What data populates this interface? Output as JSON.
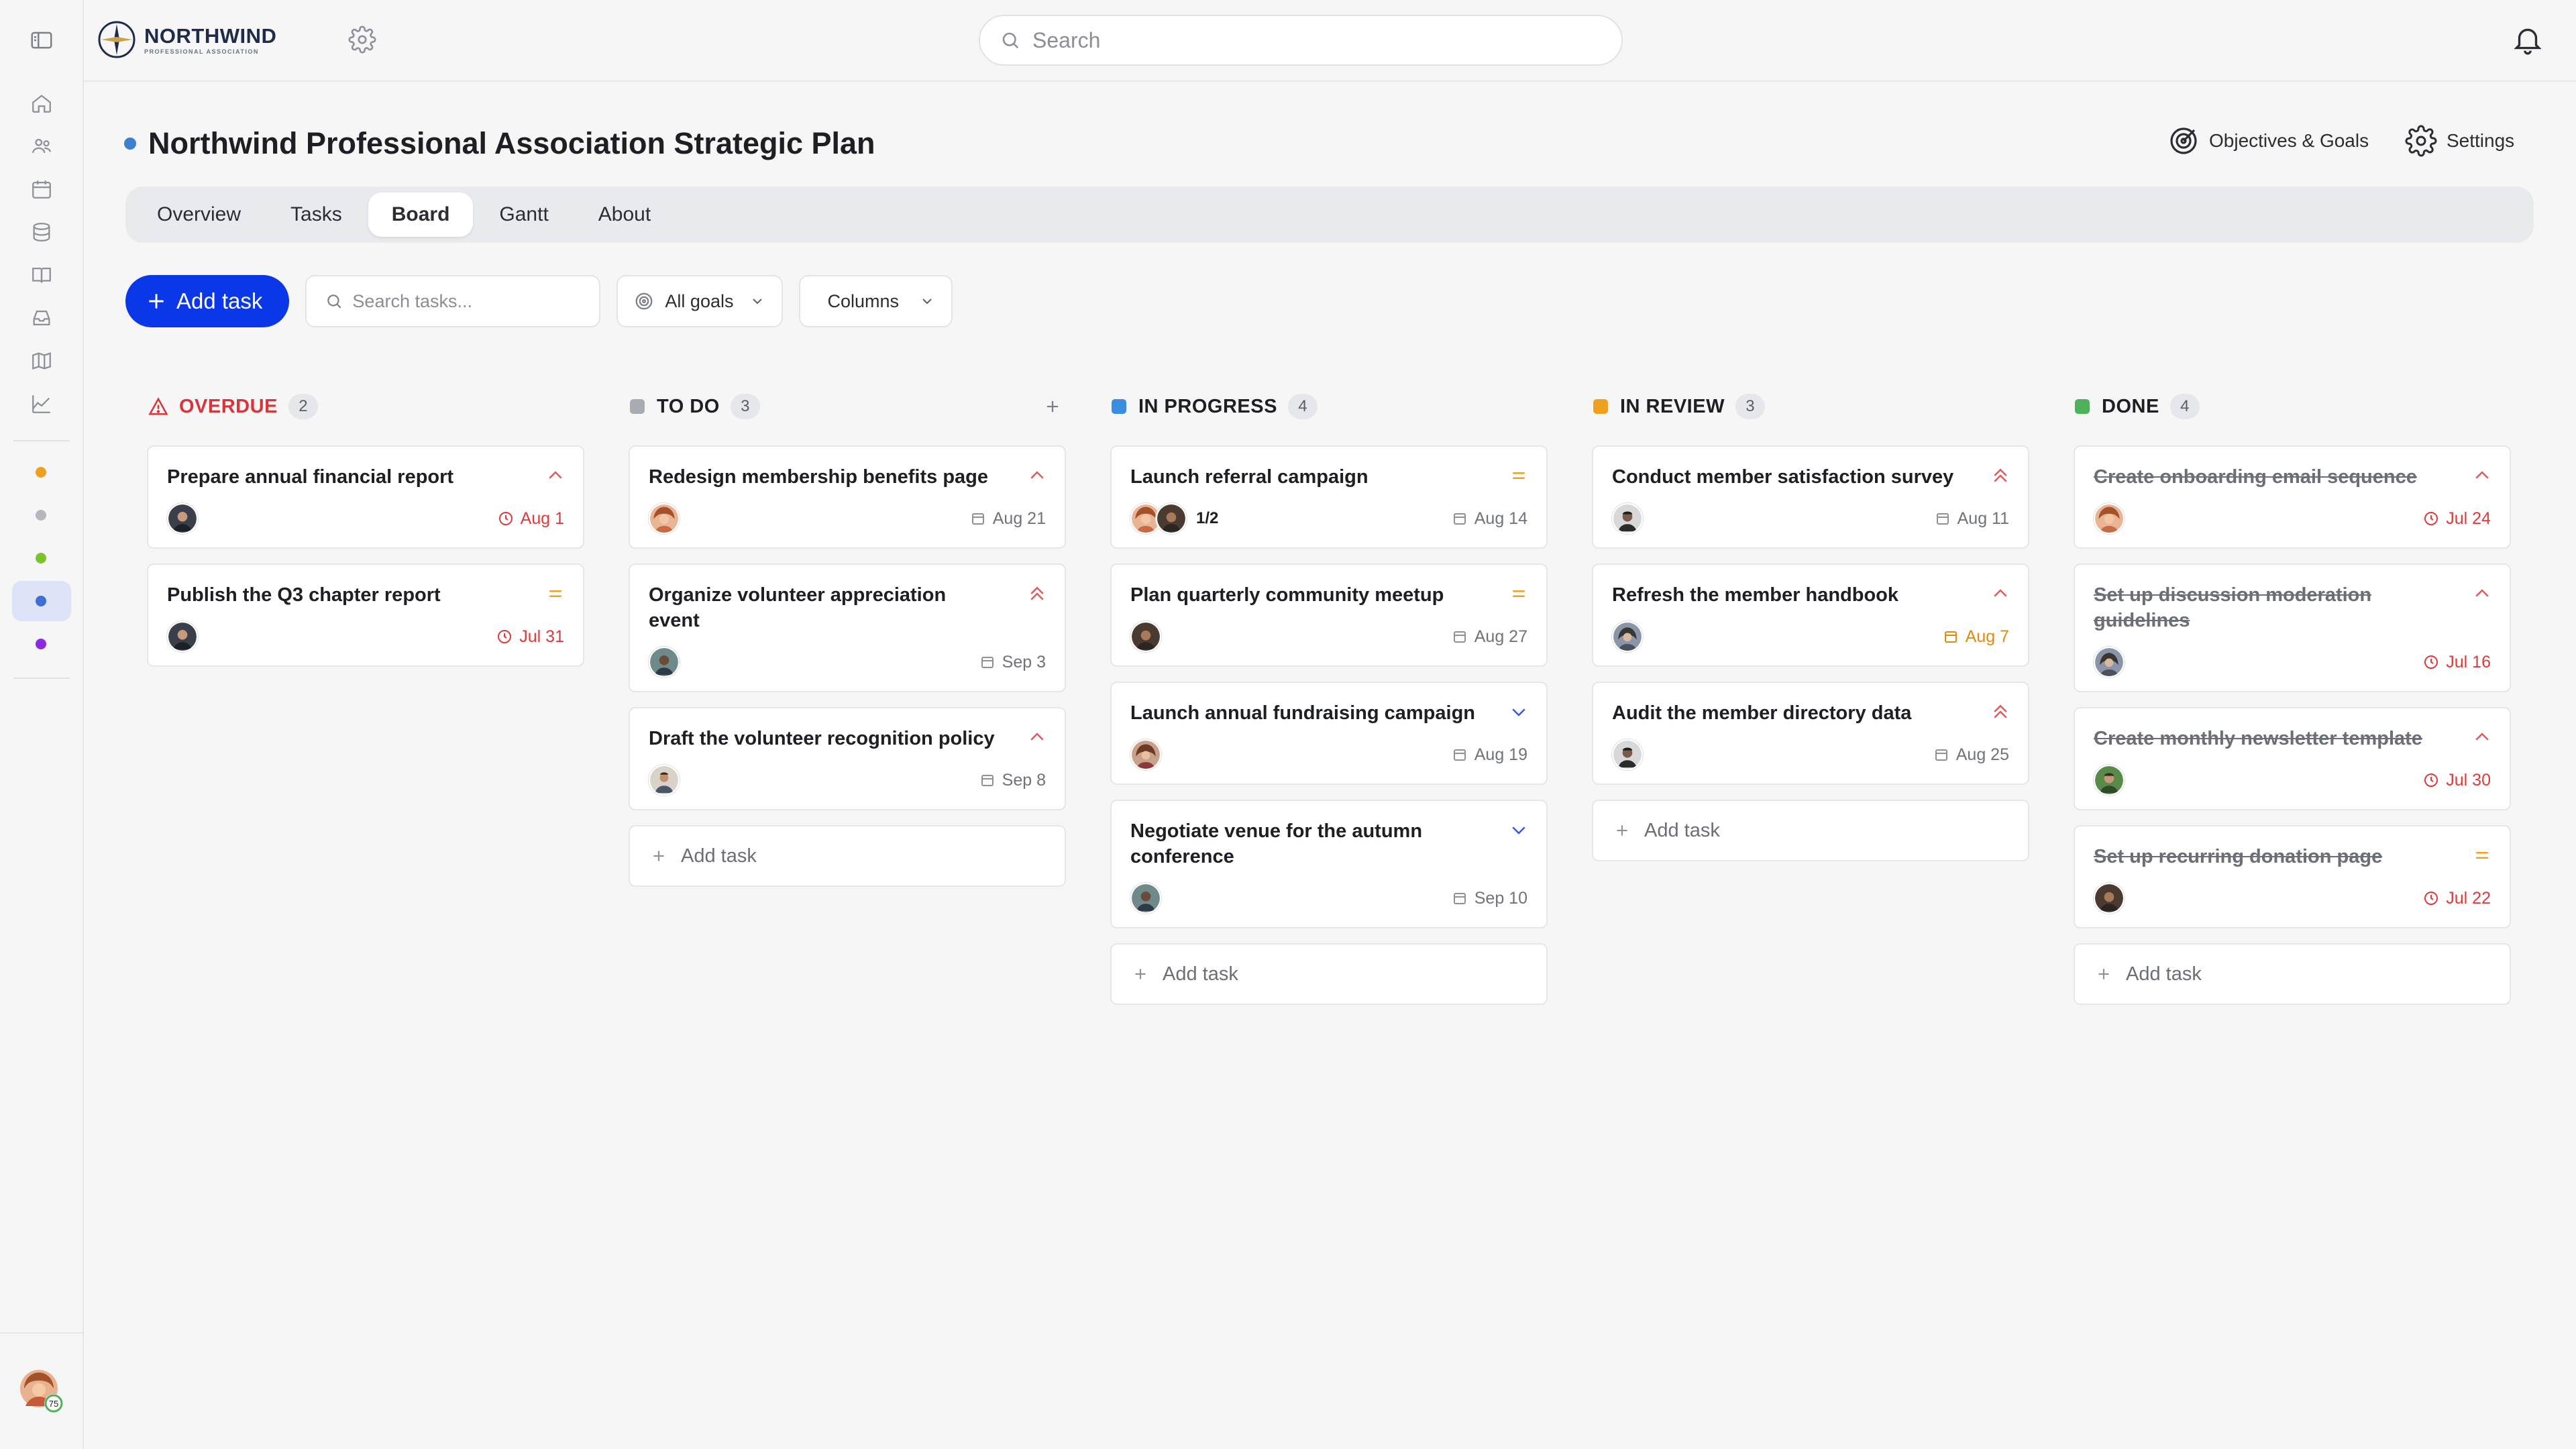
{
  "app": {
    "brand_name": "NORTHWIND",
    "brand_sub": "PROFESSIONAL ASSOCIATION"
  },
  "topbar": {
    "search_placeholder": "Search"
  },
  "project": {
    "title": "Northwind Professional Association Strategic Plan",
    "objectives_label": "Objectives & Goals",
    "settings_label": "Settings"
  },
  "tabs": [
    {
      "label": "Overview"
    },
    {
      "label": "Tasks"
    },
    {
      "label": "Board"
    },
    {
      "label": "Gantt"
    },
    {
      "label": "About"
    }
  ],
  "toolbar": {
    "add_task": "Add task",
    "search_placeholder": "Search tasks...",
    "goals_filter": "All goals",
    "columns_filter": "Columns"
  },
  "sidebar": {
    "badge": "75"
  },
  "colors": {
    "accent": "#0a38e8",
    "overdue": "#d8343a",
    "todo": "#a8abb2",
    "inprogress": "#3b8de0",
    "inreview": "#f0a020",
    "done": "#4db05a"
  },
  "columns": [
    {
      "name": "OVERDUE",
      "count": "2",
      "cards": [
        {
          "title": "Prepare annual financial report",
          "due": "Aug 1",
          "priority": "high"
        },
        {
          "title": "Publish the Q3 chapter report",
          "due": "Jul 31",
          "priority": "medium"
        }
      ]
    },
    {
      "name": "TO DO",
      "count": "3",
      "cards": [
        {
          "title": "Redesign membership benefits page",
          "due": "Aug 21",
          "priority": "high"
        },
        {
          "title": "Organize volunteer appreciation event",
          "due": "Sep 3",
          "priority": "urgent"
        },
        {
          "title": "Draft the volunteer recognition policy",
          "due": "Sep 8",
          "priority": "high"
        }
      ],
      "add_label": "Add task"
    },
    {
      "name": "IN PROGRESS",
      "count": "4",
      "cards": [
        {
          "title": "Launch referral campaign",
          "due": "Aug 14",
          "priority": "medium",
          "subtasks": "1/2"
        },
        {
          "title": "Plan quarterly community meetup",
          "due": "Aug 27",
          "priority": "medium"
        },
        {
          "title": "Launch annual fundraising campaign",
          "due": "Aug 19",
          "priority": "low"
        },
        {
          "title": "Negotiate venue for the autumn conference",
          "due": "Sep 10",
          "priority": "low"
        }
      ],
      "add_label": "Add task"
    },
    {
      "name": "IN REVIEW",
      "count": "3",
      "cards": [
        {
          "title": "Conduct member satisfaction survey",
          "due": "Aug 11",
          "priority": "urgent"
        },
        {
          "title": "Refresh the member handbook",
          "due": "Aug 7",
          "priority": "high"
        },
        {
          "title": "Audit the member directory data",
          "due": "Aug 25",
          "priority": "urgent"
        }
      ],
      "add_label": "Add task"
    },
    {
      "name": "DONE",
      "count": "4",
      "cards": [
        {
          "title": "Create onboarding email sequence",
          "due": "Jul 24",
          "priority": "high"
        },
        {
          "title": "Set up discussion moderation guidelines",
          "due": "Jul 16",
          "priority": "high"
        },
        {
          "title": "Create monthly newsletter template",
          "due": "Jul 30",
          "priority": "high"
        },
        {
          "title": "Set up recurring donation page",
          "due": "Jul 22",
          "priority": "medium"
        }
      ],
      "add_label": "Add task"
    }
  ]
}
